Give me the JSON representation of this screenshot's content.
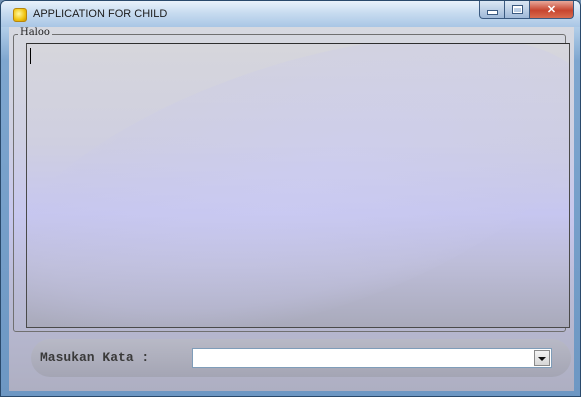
{
  "window": {
    "title": "APPLICATION FOR CHILD",
    "icon": "app-icon"
  },
  "group": {
    "legend": "Haloo"
  },
  "input": {
    "label": "Masukan Kata :",
    "value": ""
  },
  "caption_buttons": [
    "minimize-icon",
    "maximize-icon",
    "close-icon"
  ],
  "colors": {
    "titlebar": "#c8dcf0",
    "close_button": "#c7452f",
    "panel_accent": "#c6c6f0"
  }
}
